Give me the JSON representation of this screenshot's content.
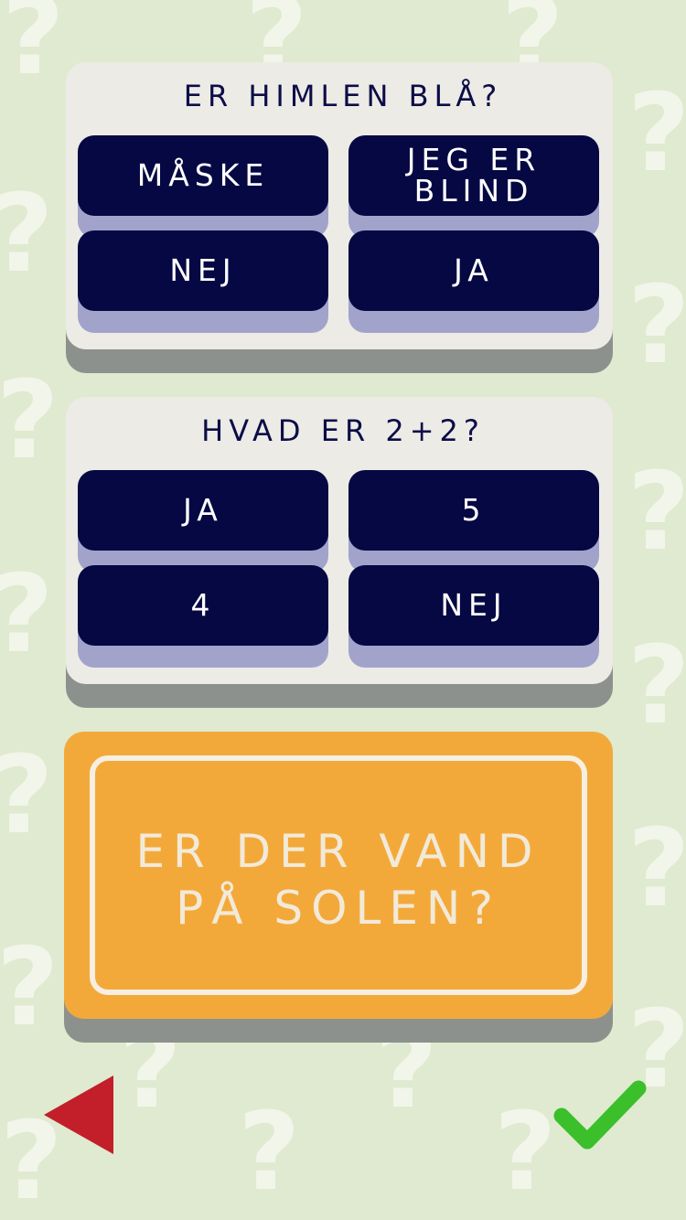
{
  "questions": [
    {
      "text": "ER HIMLEN BLÅ?",
      "answers": [
        "MÅSKE",
        "JEG ER BLIND",
        "NEJ",
        "JA"
      ]
    },
    {
      "text": "HVAD ER 2+2?",
      "answers": [
        "JA",
        "5",
        "4",
        "NEJ"
      ]
    }
  ],
  "current_question": {
    "text": "ER DER VAND PÅ SOLEN?"
  },
  "nav": {
    "back_icon": "triangle-left-icon",
    "confirm_icon": "checkmark-icon"
  },
  "colors": {
    "background": "#dfead0",
    "card": "#ecebe6",
    "answer_button": "#060843",
    "answer_shadow": "#a2a3cb",
    "highlight_card": "#f3a93a",
    "back_arrow": "#c21f2a",
    "checkmark": "#3bbf2a"
  }
}
